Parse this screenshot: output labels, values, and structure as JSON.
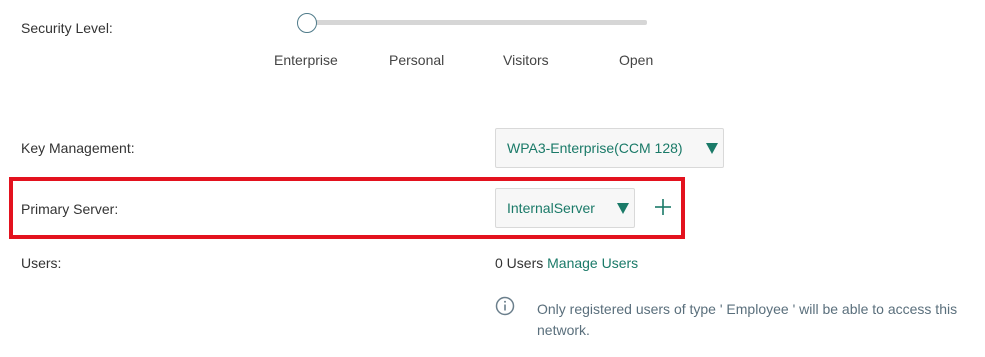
{
  "security_level": {
    "label": "Security Level:",
    "options": [
      "Enterprise",
      "Personal",
      "Visitors",
      "Open"
    ],
    "selected": "Enterprise"
  },
  "key_management": {
    "label": "Key Management:",
    "value": "WPA3-Enterprise(CCM 128)"
  },
  "primary_server": {
    "label": "Primary Server:",
    "value": "InternalServer",
    "add_icon": "plus-icon"
  },
  "users": {
    "label": "Users:",
    "count_text": "0 Users",
    "manage_link": "Manage Users"
  },
  "info": {
    "icon": "info-icon",
    "text": "Only registered users of type ' Employee ' will be able to access this network."
  },
  "colors": {
    "accent": "#1a7a68",
    "highlight": "#e3121e",
    "track": "#d6d6d6"
  }
}
